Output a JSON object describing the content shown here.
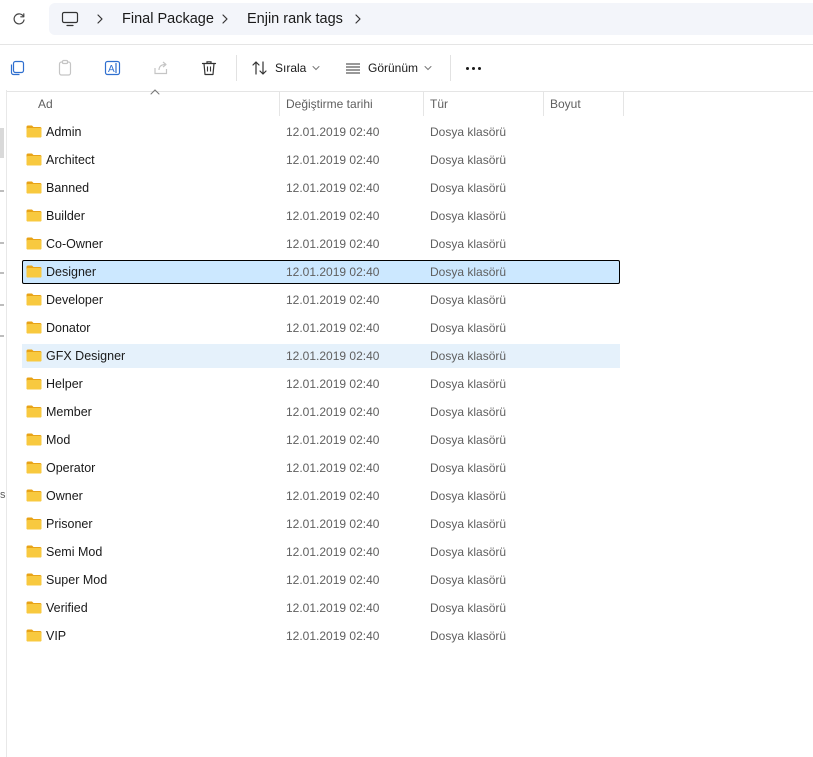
{
  "breadcrumb": {
    "items": [
      "Final Package",
      "Enjin rank tags"
    ]
  },
  "toolbar": {
    "sort_label": "Sırala",
    "view_label": "Görünüm"
  },
  "columns": {
    "name": "Ad",
    "date": "Değiştirme tarihi",
    "type": "Tür",
    "size": "Boyut"
  },
  "files": [
    {
      "name": "Admin",
      "date": "12.01.2019 02:40",
      "type": "Dosya klasörü",
      "size": ""
    },
    {
      "name": "Architect",
      "date": "12.01.2019 02:40",
      "type": "Dosya klasörü",
      "size": ""
    },
    {
      "name": "Banned",
      "date": "12.01.2019 02:40",
      "type": "Dosya klasörü",
      "size": ""
    },
    {
      "name": "Builder",
      "date": "12.01.2019 02:40",
      "type": "Dosya klasörü",
      "size": ""
    },
    {
      "name": "Co-Owner",
      "date": "12.01.2019 02:40",
      "type": "Dosya klasörü",
      "size": ""
    },
    {
      "name": "Designer",
      "date": "12.01.2019 02:40",
      "type": "Dosya klasörü",
      "size": "",
      "state": "selected"
    },
    {
      "name": "Developer",
      "date": "12.01.2019 02:40",
      "type": "Dosya klasörü",
      "size": ""
    },
    {
      "name": "Donator",
      "date": "12.01.2019 02:40",
      "type": "Dosya klasörü",
      "size": ""
    },
    {
      "name": "GFX Designer",
      "date": "12.01.2019 02:40",
      "type": "Dosya klasörü",
      "size": "",
      "state": "hover"
    },
    {
      "name": "Helper",
      "date": "12.01.2019 02:40",
      "type": "Dosya klasörü",
      "size": ""
    },
    {
      "name": "Member",
      "date": "12.01.2019 02:40",
      "type": "Dosya klasörü",
      "size": ""
    },
    {
      "name": "Mod",
      "date": "12.01.2019 02:40",
      "type": "Dosya klasörü",
      "size": ""
    },
    {
      "name": "Operator",
      "date": "12.01.2019 02:40",
      "type": "Dosya klasörü",
      "size": ""
    },
    {
      "name": "Owner",
      "date": "12.01.2019 02:40",
      "type": "Dosya klasörü",
      "size": ""
    },
    {
      "name": "Prisoner",
      "date": "12.01.2019 02:40",
      "type": "Dosya klasörü",
      "size": ""
    },
    {
      "name": "Semi Mod",
      "date": "12.01.2019 02:40",
      "type": "Dosya klasörü",
      "size": ""
    },
    {
      "name": "Super Mod",
      "date": "12.01.2019 02:40",
      "type": "Dosya klasörü",
      "size": ""
    },
    {
      "name": "Verified",
      "date": "12.01.2019 02:40",
      "type": "Dosya klasörü",
      "size": ""
    },
    {
      "name": "VIP",
      "date": "12.01.2019 02:40",
      "type": "Dosya klasörü",
      "size": ""
    }
  ],
  "nav_edge_text": "s",
  "colors": {
    "accent": "#0067c0",
    "selected_bg": "#cce8ff",
    "hover_bg": "#e5f1fb",
    "folder": "#f8c93f"
  },
  "icons": {
    "refresh": "refresh-icon",
    "this_pc": "monitor-icon",
    "copy": "copy-icon",
    "paste": "paste-icon",
    "rename": "rename-icon",
    "share": "share-icon",
    "delete": "trash-icon",
    "sort": "sort-icon",
    "view": "view-list-icon",
    "more": "more-icon",
    "folder": "folder-icon"
  }
}
